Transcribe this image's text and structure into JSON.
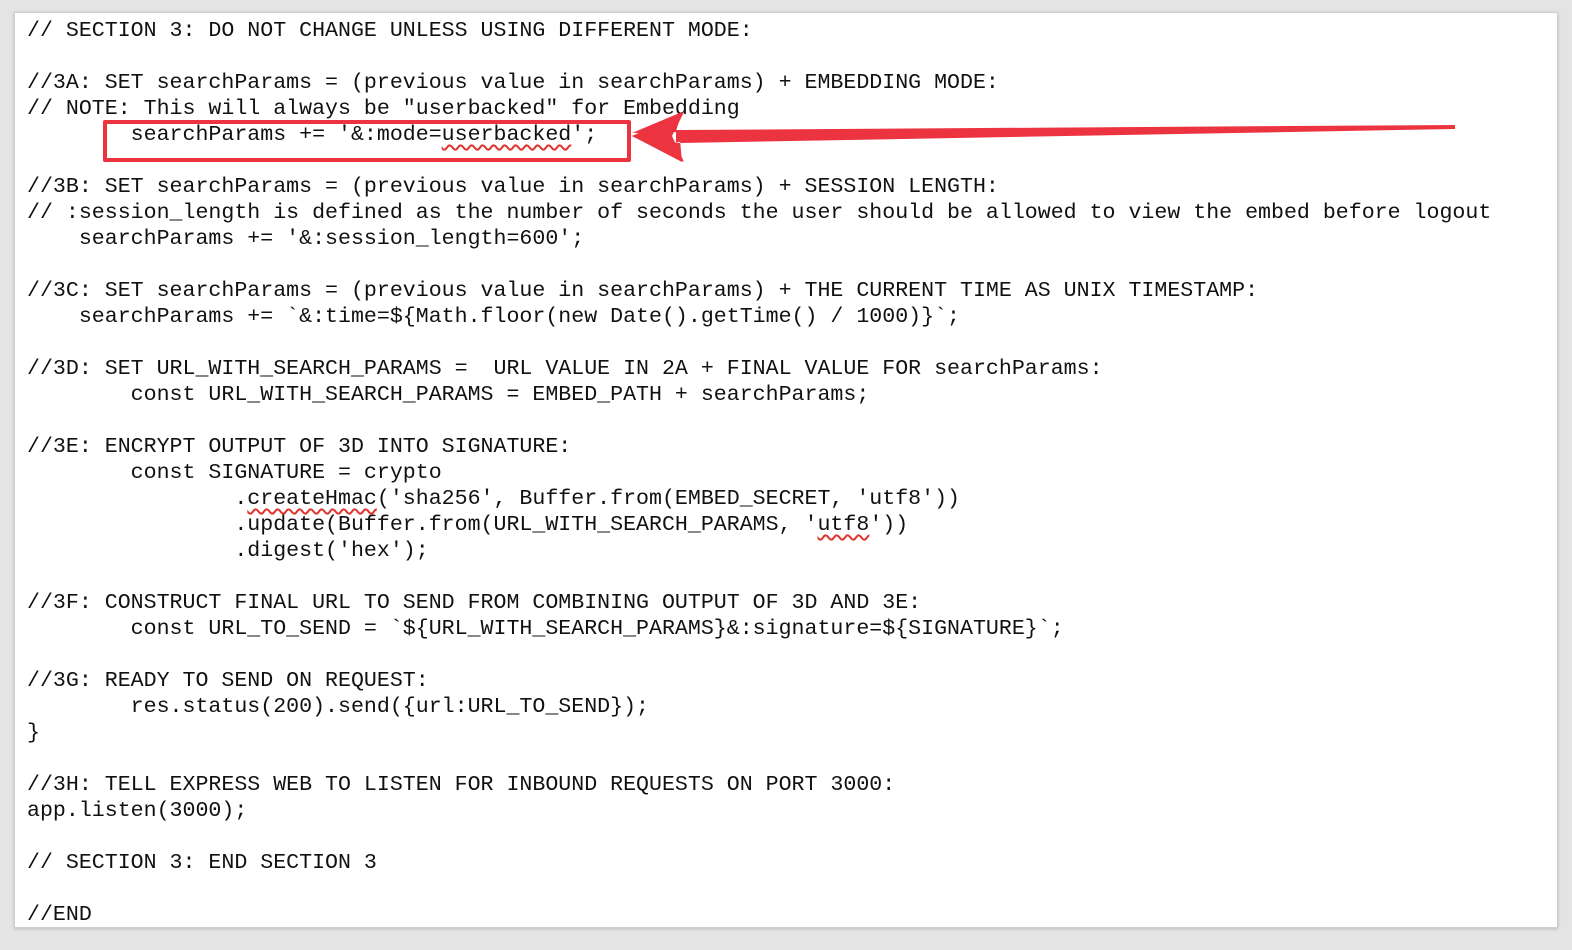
{
  "colors": {
    "annotation": "#ec3340",
    "spellcheck": "#e0342f",
    "text": "#111111",
    "background": "#ffffff"
  },
  "editor": {
    "lines": [
      "// SECTION 3: DO NOT CHANGE UNLESS USING DIFFERENT MODE:",
      "",
      "//3A: SET searchParams = (previous value in searchParams) + EMBEDDING MODE:",
      "// NOTE: This will always be \"userbacked\" for Embedding",
      "        searchParams += '&:mode=userbacked';",
      "",
      "//3B: SET searchParams = (previous value in searchParams) + SESSION LENGTH:",
      "// :session_length is defined as the number of seconds the user should be allowed to view the embed before logout",
      "    searchParams += '&:session_length=600';",
      "",
      "//3C: SET searchParams = (previous value in searchParams) + THE CURRENT TIME AS UNIX TIMESTAMP:",
      "    searchParams += `&:time=${Math.floor(new Date().getTime() / 1000)}`;",
      "",
      "//3D: SET URL_WITH_SEARCH_PARAMS =  URL VALUE IN 2A + FINAL VALUE FOR searchParams:",
      "        const URL_WITH_SEARCH_PARAMS = EMBED_PATH + searchParams;",
      "",
      "//3E: ENCRYPT OUTPUT OF 3D INTO SIGNATURE:",
      "        const SIGNATURE = crypto",
      "                .createHmac('sha256', Buffer.from(EMBED_SECRET, 'utf8'))",
      "                .update(Buffer.from(URL_WITH_SEARCH_PARAMS, 'utf8'))",
      "                .digest('hex');",
      "",
      "//3F: CONSTRUCT FINAL URL TO SEND FROM COMBINING OUTPUT OF 3D AND 3E:",
      "        const URL_TO_SEND = `${URL_WITH_SEARCH_PARAMS}&:signature=${SIGNATURE}`;",
      "",
      "//3G: READY TO SEND ON REQUEST:",
      "        res.status(200).send({url:URL_TO_SEND});",
      "}",
      "",
      "//3H: TELL EXPRESS WEB TO LISTEN FOR INBOUND REQUESTS ON PORT 3000:",
      "app.listen(3000);",
      "",
      "// SECTION 3: END SECTION 3",
      "",
      "//END"
    ],
    "spellcheck_words": [
      "userbacked",
      "createHmac",
      "utf8"
    ],
    "spellcheck_lines": [
      4,
      18,
      19
    ]
  }
}
